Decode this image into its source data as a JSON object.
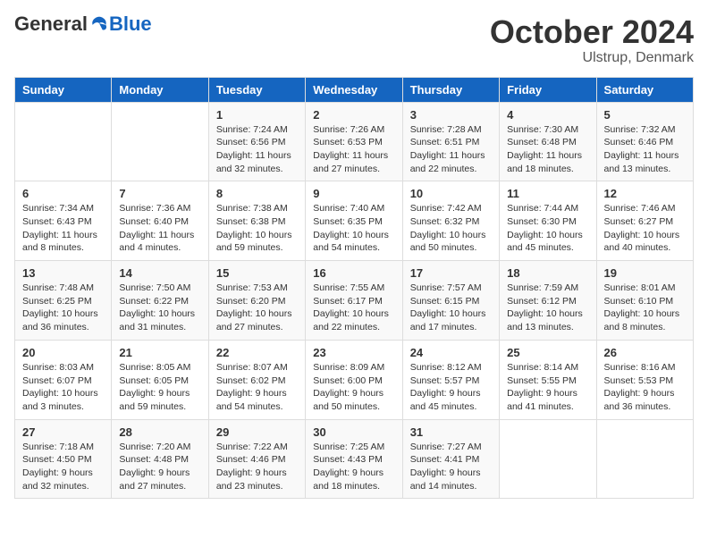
{
  "header": {
    "logo_general": "General",
    "logo_blue": "Blue",
    "month_title": "October 2024",
    "location": "Ulstrup, Denmark"
  },
  "weekdays": [
    "Sunday",
    "Monday",
    "Tuesday",
    "Wednesday",
    "Thursday",
    "Friday",
    "Saturday"
  ],
  "weeks": [
    [
      {
        "day": "",
        "info": ""
      },
      {
        "day": "",
        "info": ""
      },
      {
        "day": "1",
        "info": "Sunrise: 7:24 AM\nSunset: 6:56 PM\nDaylight: 11 hours and 32 minutes."
      },
      {
        "day": "2",
        "info": "Sunrise: 7:26 AM\nSunset: 6:53 PM\nDaylight: 11 hours and 27 minutes."
      },
      {
        "day": "3",
        "info": "Sunrise: 7:28 AM\nSunset: 6:51 PM\nDaylight: 11 hours and 22 minutes."
      },
      {
        "day": "4",
        "info": "Sunrise: 7:30 AM\nSunset: 6:48 PM\nDaylight: 11 hours and 18 minutes."
      },
      {
        "day": "5",
        "info": "Sunrise: 7:32 AM\nSunset: 6:46 PM\nDaylight: 11 hours and 13 minutes."
      }
    ],
    [
      {
        "day": "6",
        "info": "Sunrise: 7:34 AM\nSunset: 6:43 PM\nDaylight: 11 hours and 8 minutes."
      },
      {
        "day": "7",
        "info": "Sunrise: 7:36 AM\nSunset: 6:40 PM\nDaylight: 11 hours and 4 minutes."
      },
      {
        "day": "8",
        "info": "Sunrise: 7:38 AM\nSunset: 6:38 PM\nDaylight: 10 hours and 59 minutes."
      },
      {
        "day": "9",
        "info": "Sunrise: 7:40 AM\nSunset: 6:35 PM\nDaylight: 10 hours and 54 minutes."
      },
      {
        "day": "10",
        "info": "Sunrise: 7:42 AM\nSunset: 6:32 PM\nDaylight: 10 hours and 50 minutes."
      },
      {
        "day": "11",
        "info": "Sunrise: 7:44 AM\nSunset: 6:30 PM\nDaylight: 10 hours and 45 minutes."
      },
      {
        "day": "12",
        "info": "Sunrise: 7:46 AM\nSunset: 6:27 PM\nDaylight: 10 hours and 40 minutes."
      }
    ],
    [
      {
        "day": "13",
        "info": "Sunrise: 7:48 AM\nSunset: 6:25 PM\nDaylight: 10 hours and 36 minutes."
      },
      {
        "day": "14",
        "info": "Sunrise: 7:50 AM\nSunset: 6:22 PM\nDaylight: 10 hours and 31 minutes."
      },
      {
        "day": "15",
        "info": "Sunrise: 7:53 AM\nSunset: 6:20 PM\nDaylight: 10 hours and 27 minutes."
      },
      {
        "day": "16",
        "info": "Sunrise: 7:55 AM\nSunset: 6:17 PM\nDaylight: 10 hours and 22 minutes."
      },
      {
        "day": "17",
        "info": "Sunrise: 7:57 AM\nSunset: 6:15 PM\nDaylight: 10 hours and 17 minutes."
      },
      {
        "day": "18",
        "info": "Sunrise: 7:59 AM\nSunset: 6:12 PM\nDaylight: 10 hours and 13 minutes."
      },
      {
        "day": "19",
        "info": "Sunrise: 8:01 AM\nSunset: 6:10 PM\nDaylight: 10 hours and 8 minutes."
      }
    ],
    [
      {
        "day": "20",
        "info": "Sunrise: 8:03 AM\nSunset: 6:07 PM\nDaylight: 10 hours and 3 minutes."
      },
      {
        "day": "21",
        "info": "Sunrise: 8:05 AM\nSunset: 6:05 PM\nDaylight: 9 hours and 59 minutes."
      },
      {
        "day": "22",
        "info": "Sunrise: 8:07 AM\nSunset: 6:02 PM\nDaylight: 9 hours and 54 minutes."
      },
      {
        "day": "23",
        "info": "Sunrise: 8:09 AM\nSunset: 6:00 PM\nDaylight: 9 hours and 50 minutes."
      },
      {
        "day": "24",
        "info": "Sunrise: 8:12 AM\nSunset: 5:57 PM\nDaylight: 9 hours and 45 minutes."
      },
      {
        "day": "25",
        "info": "Sunrise: 8:14 AM\nSunset: 5:55 PM\nDaylight: 9 hours and 41 minutes."
      },
      {
        "day": "26",
        "info": "Sunrise: 8:16 AM\nSunset: 5:53 PM\nDaylight: 9 hours and 36 minutes."
      }
    ],
    [
      {
        "day": "27",
        "info": "Sunrise: 7:18 AM\nSunset: 4:50 PM\nDaylight: 9 hours and 32 minutes."
      },
      {
        "day": "28",
        "info": "Sunrise: 7:20 AM\nSunset: 4:48 PM\nDaylight: 9 hours and 27 minutes."
      },
      {
        "day": "29",
        "info": "Sunrise: 7:22 AM\nSunset: 4:46 PM\nDaylight: 9 hours and 23 minutes."
      },
      {
        "day": "30",
        "info": "Sunrise: 7:25 AM\nSunset: 4:43 PM\nDaylight: 9 hours and 18 minutes."
      },
      {
        "day": "31",
        "info": "Sunrise: 7:27 AM\nSunset: 4:41 PM\nDaylight: 9 hours and 14 minutes."
      },
      {
        "day": "",
        "info": ""
      },
      {
        "day": "",
        "info": ""
      }
    ]
  ]
}
